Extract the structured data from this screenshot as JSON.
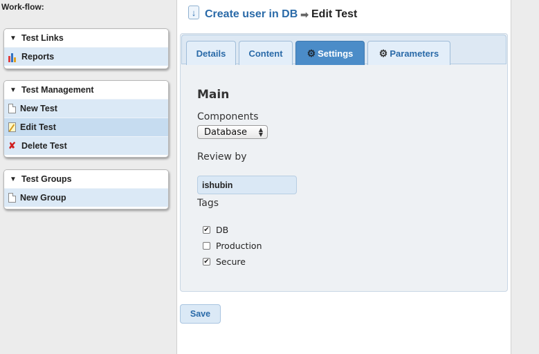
{
  "workflow": {
    "title": "Work-flow:"
  },
  "panels": {
    "test_links": {
      "header": "Test Links",
      "items": [
        {
          "label": "Reports",
          "icon": "bar-chart-icon"
        }
      ]
    },
    "test_management": {
      "header": "Test Management",
      "items": [
        {
          "label": "New Test",
          "icon": "document-icon"
        },
        {
          "label": "Edit Test",
          "icon": "edit-document-icon",
          "active": true
        },
        {
          "label": "Delete Test",
          "icon": "delete-x-icon"
        }
      ]
    },
    "test_groups": {
      "header": "Test Groups",
      "items": [
        {
          "label": "New Group",
          "icon": "document-icon"
        }
      ]
    }
  },
  "breadcrumb": {
    "link": "Create user in DB",
    "separator": "➡",
    "current": "Edit Test"
  },
  "tabs": [
    {
      "label": "Details",
      "active": false
    },
    {
      "label": "Content",
      "active": false
    },
    {
      "label": "Settings",
      "active": true,
      "icon": "gear-icon"
    },
    {
      "label": "Parameters",
      "active": false,
      "icon": "gear-icon"
    }
  ],
  "form": {
    "section_title": "Main",
    "components_label": "Components",
    "components_value": "Database",
    "review_label": "Review by",
    "review_value": "ishubin",
    "tags_label": "Tags",
    "tags": [
      {
        "label": "DB",
        "checked": true
      },
      {
        "label": "Production",
        "checked": false
      },
      {
        "label": "Secure",
        "checked": true
      }
    ]
  },
  "actions": {
    "save": "Save"
  },
  "colors": {
    "accent": "#4b8cc8",
    "link": "#2a6aa8",
    "item_bg": "#dbe9f6"
  }
}
